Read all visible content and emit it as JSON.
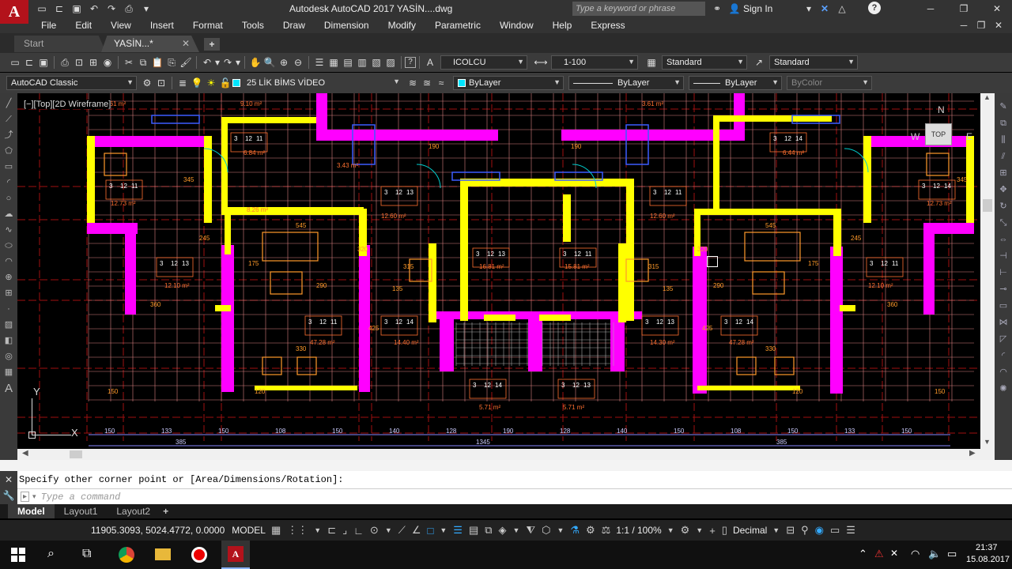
{
  "title_bar": {
    "title": "Autodesk AutoCAD 2017    YASİN....dwg",
    "search_placeholder": "Type a keyword or phrase",
    "sign_in": "Sign In",
    "logo_letter": "A"
  },
  "menu": [
    "File",
    "Edit",
    "View",
    "Insert",
    "Format",
    "Tools",
    "Draw",
    "Dimension",
    "Modify",
    "Parametric",
    "Window",
    "Help",
    "Express"
  ],
  "doc_tabs": {
    "start": "Start",
    "active": "YASİN...*"
  },
  "toolbar1": {
    "text_style": "ICOLCU",
    "dim_style": "1-100",
    "table_style": "Standard",
    "mleader_style": "Standard"
  },
  "toolbar2": {
    "workspace": "AutoCAD Classic",
    "layer": "25 LİK BİMS VİDEO",
    "color": "ByLayer",
    "linetype": "ByLayer",
    "lineweight": "ByLayer",
    "plotstyle": "ByColor"
  },
  "viewport_label": "[−][Top][2D Wireframe]",
  "viewcube": {
    "face": "TOP",
    "n": "N",
    "w": "W",
    "e": "E"
  },
  "ucs": {
    "y": "Y",
    "x": "X"
  },
  "drawing": {
    "areas": [
      "6.61 m²",
      "9.10 m²",
      "3.61 m²",
      "12.73 m²",
      "12.73 m²",
      "12.60 m²",
      "12.60 m²",
      "16.81 m²",
      "15.81 m²",
      "14.40 m²",
      "14.30 m²",
      "47.28 m²",
      "47.28 m²",
      "12.10 m²",
      "12.10 m²",
      "5.71 m²",
      "5.71 m²",
      "6.84 m²",
      "6.44 m²",
      "3.43 m²",
      "8.26 m²"
    ],
    "dims": [
      "545",
      "545",
      "330",
      "330",
      "315",
      "315",
      "175",
      "175",
      "345",
      "345",
      "135",
      "135",
      "190",
      "190",
      "360",
      "360",
      "425",
      "425",
      "290",
      "290",
      "245",
      "245",
      "120",
      "120",
      "150",
      "150",
      "320",
      "320"
    ],
    "bottom_dims": [
      "150",
      "133",
      "150",
      "108",
      "150",
      "140",
      "128",
      "190",
      "128",
      "140",
      "150",
      "108",
      "150",
      "133",
      "150"
    ],
    "bottom_totals": [
      "385",
      "1345",
      "385"
    ],
    "table_nums": [
      "3",
      "12",
      "11",
      "3",
      "12",
      "14",
      "3",
      "12",
      "13"
    ]
  },
  "command": {
    "history": "Specify other corner point or [Area/Dimensions/Rotation]:",
    "placeholder": "Type a command"
  },
  "layout_tabs": [
    "Model",
    "Layout1",
    "Layout2"
  ],
  "status": {
    "coords": "11905.3093, 5024.4772, 0.0000",
    "space": "MODEL",
    "scale": "1:1 / 100%",
    "units": "Decimal"
  },
  "taskbar": {
    "time": "21:37",
    "date": "15.08.2017"
  }
}
